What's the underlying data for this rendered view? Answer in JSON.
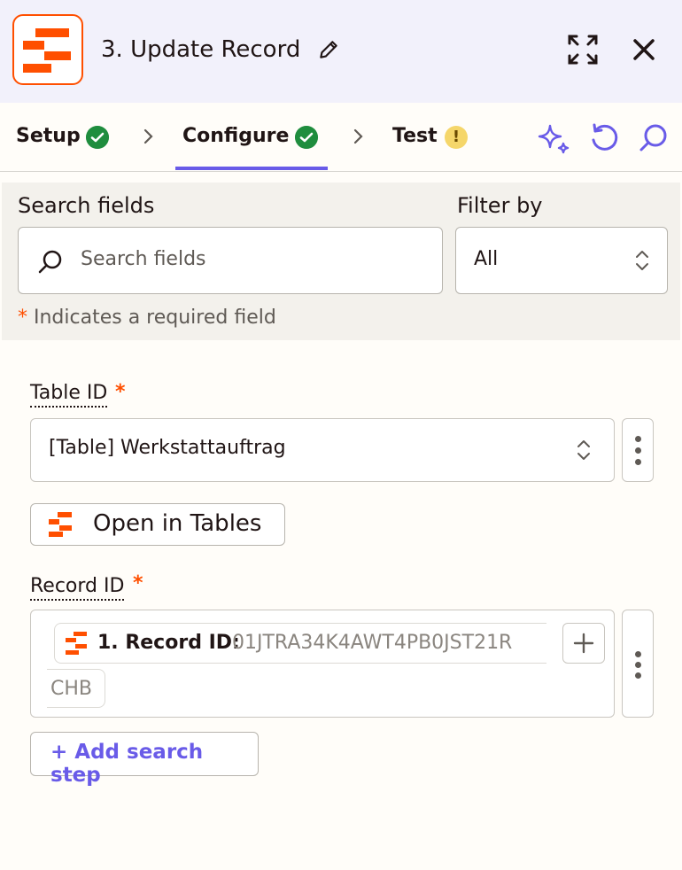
{
  "header": {
    "title": "3. Update Record",
    "brand_color": "#ff4f00",
    "icons": [
      "edit-icon",
      "expand-icon",
      "close-icon"
    ]
  },
  "tabs": [
    {
      "label": "Setup",
      "status": "complete"
    },
    {
      "label": "Configure",
      "status": "complete",
      "active": true
    },
    {
      "label": "Test",
      "status": "warning",
      "status_glyph": "!"
    }
  ],
  "toolbar_icons": [
    "sparkle-icon",
    "undo-icon",
    "search-icon"
  ],
  "search": {
    "label": "Search fields",
    "placeholder": "Search fields",
    "filter_label": "Filter by",
    "filter_value": "All",
    "required_note": "Indicates a required field",
    "required_marker": "*"
  },
  "fields": {
    "table_id": {
      "label": "Table ID",
      "required_marker": "*",
      "value": "[Table] Werkstattauftrag"
    },
    "open_button_label": "Open in Tables",
    "record_id": {
      "label": "Record ID",
      "required_marker": "*",
      "pill_name": "1. Record ID:",
      "pill_value": "01JTRA34K4AWT4PB0JST21R",
      "pill_value_cont": "CHB"
    },
    "add_search_step": "+ Add search step"
  },
  "colors": {
    "accent": "#695be8",
    "success": "#1f8d3e",
    "warning": "#f5d66a",
    "header_bg": "#f2f1fb"
  }
}
